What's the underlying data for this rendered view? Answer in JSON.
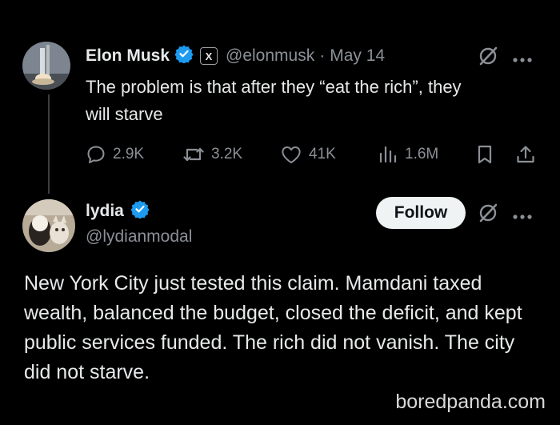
{
  "main_tweet": {
    "author_name": "Elon Musk",
    "affiliate_badge": "X",
    "handle": "@elonmusk",
    "separator": "·",
    "date": "May 14",
    "text_line1": "The problem is that after they “eat the rich”, they",
    "text_line2": "will starve",
    "stats": {
      "replies": "2.9K",
      "reposts": "3.2K",
      "likes": "41K",
      "views": "1.6M"
    }
  },
  "reply_tweet": {
    "author_name": "lydia",
    "handle": "@lydianmodal",
    "follow_label": "Follow",
    "text": "New York City just tested this claim. Mamdani taxed wealth, balanced the budget, closed the deficit, and kept public services funded. The rich did not vanish. The city did not starve."
  },
  "watermark": "boredpanda.com",
  "colors": {
    "background": "#000000",
    "text": "#e7e9ea",
    "muted": "#8b9096",
    "verified": "#1d9bf0",
    "follow_bg": "#eff3f4"
  },
  "icons": [
    "reply-icon",
    "repost-icon",
    "like-icon",
    "views-icon",
    "bookmark-icon",
    "share-icon",
    "grok-icon",
    "more-icon",
    "verified-icon"
  ]
}
